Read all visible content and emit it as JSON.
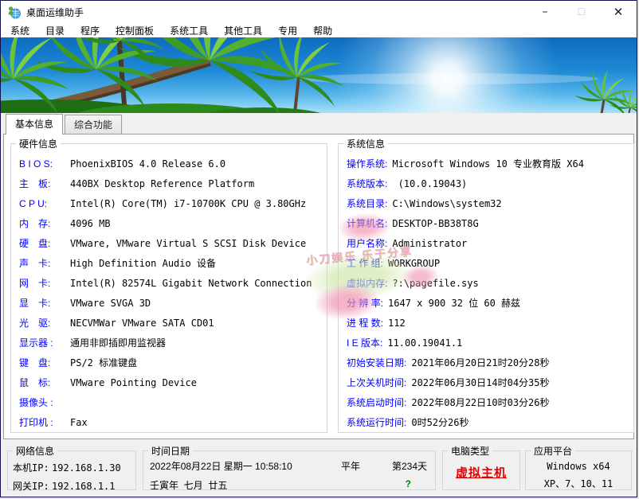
{
  "window": {
    "title": "桌面运维助手",
    "controls": {
      "minimize": "–",
      "maximize": "☐",
      "close": "✕"
    }
  },
  "menu": {
    "items": [
      "系统",
      "目录",
      "程序",
      "控制面板",
      "系统工具",
      "其他工具",
      "专用",
      "帮助"
    ]
  },
  "tabs": [
    {
      "label": "基本信息",
      "active": true
    },
    {
      "label": "综合功能",
      "active": false
    }
  ],
  "hardware": {
    "title": "硬件信息",
    "rows": [
      {
        "label": "B I O S:",
        "value": "PhoenixBIOS 4.0 Release 6.0"
      },
      {
        "label": "主　板:",
        "value": "440BX Desktop Reference Platform"
      },
      {
        "label": "C P U:",
        "value": "Intel(R) Core(TM) i7-10700K CPU @ 3.80GHz"
      },
      {
        "label": "内　存:",
        "value": "4096 MB"
      },
      {
        "label": "硬　盘:",
        "value": "VMware, VMware Virtual S SCSI Disk Device"
      },
      {
        "label": "声　卡:",
        "value": "High Definition Audio 设备"
      },
      {
        "label": "网　卡:",
        "value": "Intel(R) 82574L Gigabit Network Connection"
      },
      {
        "label": "显　卡:",
        "value": "VMware SVGA 3D"
      },
      {
        "label": "光　驱:",
        "value": "NECVMWar VMware SATA CD01"
      },
      {
        "label": "显示器 :",
        "value": "通用非即插即用监视器"
      },
      {
        "label": "键　盘:",
        "value": "PS/2 标准键盘"
      },
      {
        "label": "鼠　标:",
        "value": "VMware Pointing Device"
      },
      {
        "label": "摄像头 :",
        "value": ""
      },
      {
        "label": "打印机 :",
        "value": "Fax"
      }
    ]
  },
  "system": {
    "title": "系统信息",
    "rows": [
      {
        "label": "操作系统:",
        "value": "Microsoft Windows 10 专业教育版 X64"
      },
      {
        "label": "系统版本:",
        "value": " (10.0.19043)"
      },
      {
        "label": "系统目录:",
        "value": "C:\\Windows\\system32"
      },
      {
        "label": "计算机名:",
        "value": "DESKTOP-BB38T8G"
      },
      {
        "label": "用户名称:",
        "value": "Administrator"
      },
      {
        "label": "工 作 组:",
        "value": "WORKGROUP"
      },
      {
        "label": "虚拟内存:",
        "value": "?:\\pagefile.sys"
      },
      {
        "label": "分 辨 率:",
        "value": "1647 x 900 32 位 60 赫兹"
      },
      {
        "label": "进 程 数:",
        "value": "112"
      },
      {
        "label": "I E 版本:",
        "value": "11.00.19041.1"
      },
      {
        "label": "初始安装日期:",
        "value": "2021年06月20日21时20分28秒"
      },
      {
        "label": "上次关机时间:",
        "value": "2022年06月30日14时04分35秒"
      },
      {
        "label": "系统启动时间:",
        "value": "2022年08月22日10时03分26秒"
      },
      {
        "label": "系统运行时间:",
        "value": "0时52分26秒"
      }
    ]
  },
  "watermark": {
    "text": "小刀娱乐 乐于分享"
  },
  "network": {
    "title": "网络信息",
    "rows": [
      {
        "label": "本机IP:",
        "value": "192.168.1.30"
      },
      {
        "label": "网关IP:",
        "value": "192.168.1.1"
      }
    ]
  },
  "datetime": {
    "title": "时间日期",
    "date_line": "2022年08月22日 星期一 10:58:10",
    "year_type": "平年",
    "day_of_year": "第234天",
    "lunar_line": "壬寅年  七月  廿五",
    "help_mark": "?"
  },
  "computer_type": {
    "title": "电脑类型",
    "value": "虚拟主机"
  },
  "platform": {
    "title": "应用平台",
    "line1": "Windows x64",
    "line2": "XP、7、10、11"
  },
  "colors": {
    "label_blue": "#0000ff",
    "virtual_host_red": "#e60000",
    "help_green": "#008000",
    "window_border": "#10104f"
  }
}
